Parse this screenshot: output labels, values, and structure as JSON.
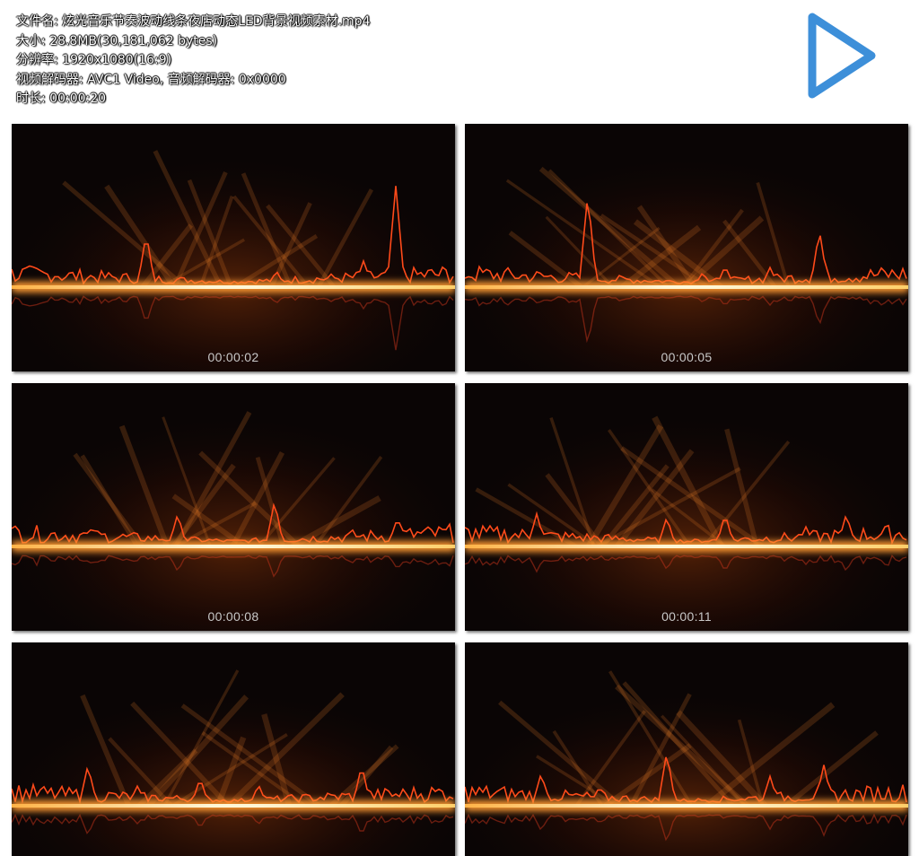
{
  "file_info": {
    "filename": "文件名: 炫光音乐节奏波动线条夜店动态LED背景视频素材.mp4",
    "size": "大小: 28.8MB(30,181,062 bytes)",
    "resolution": "分辨率: 1920x1080(16:9)",
    "codec": "视频解码器: AVC1 Video, 音频解码器: 0x0000",
    "duration": "时长: 00:00:20"
  },
  "play_button": {
    "icon": "play-icon",
    "color": "#3d8fd9"
  },
  "thumbnails": [
    {
      "timestamp": "00:00:02"
    },
    {
      "timestamp": "00:00:05"
    },
    {
      "timestamp": "00:00:08"
    },
    {
      "timestamp": "00:00:11"
    },
    {
      "timestamp": ""
    },
    {
      "timestamp": ""
    }
  ],
  "colors": {
    "glow": "#fff2c0",
    "wave": "#ff4a1a",
    "background": "#0a0505"
  }
}
